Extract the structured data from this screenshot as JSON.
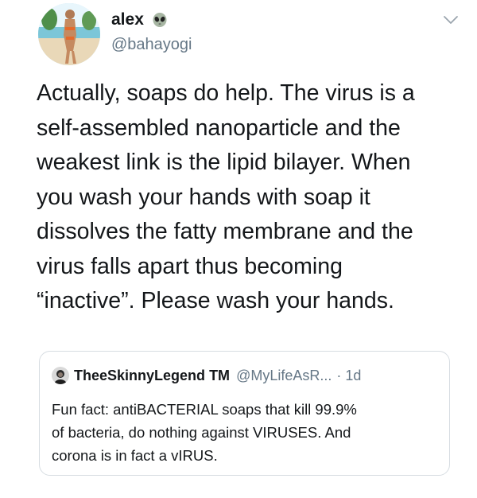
{
  "tweet": {
    "author": {
      "display_name": "alex",
      "name_emoji_icon": "alien-face-icon",
      "handle": "@bahayogi"
    },
    "menu_icon": "chevron-down-icon",
    "text_lines": [
      "Actually, soaps do help. The virus is a",
      "self-assembled nanoparticle and the",
      "weakest link is the lipid bilayer. When",
      "you wash your hands with soap it",
      "dissolves the fatty membrane and the",
      "virus falls apart thus becoming",
      "“inactive”. Please wash your hands."
    ]
  },
  "quoted_tweet": {
    "display_name": "TheeSkinnyLegend",
    "name_suffix": "TM",
    "handle": "@MyLifeAsR...",
    "time": "· 1d",
    "text_lines": [
      "Fun fact: antiBACTERIAL soaps that kill 99.9%",
      "of bacteria, do nothing against VIRUSES. And",
      "corona is in fact a vIRUS."
    ]
  },
  "colors": {
    "text": "#14171a",
    "secondary_text": "#657786",
    "border": "#d7dde2"
  }
}
